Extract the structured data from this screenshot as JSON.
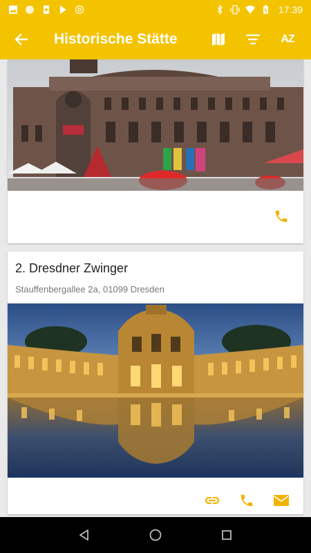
{
  "status_bar": {
    "time": "17:39",
    "left_icons": [
      "image-icon",
      "circle-icon",
      "battery-saver-icon",
      "play-store-icon",
      "at-sign-icon"
    ],
    "right_icons": [
      "bluetooth-icon",
      "vibrate-icon",
      "wifi-icon",
      "battery-icon"
    ]
  },
  "app_bar": {
    "title": "Historische Stätte",
    "back_icon": "arrow-left-icon",
    "actions": [
      "map-icon",
      "filter-icon",
      "sort-az-icon"
    ],
    "sort_label": "AZ"
  },
  "cards": [
    {
      "title": "",
      "address": "",
      "image": "semperoper-photo",
      "actions": [
        "phone-icon"
      ]
    },
    {
      "title": "2. Dresdner Zwinger",
      "address": "Stauffenbergallee 2a, 01099 Dresden",
      "image": "zwinger-photo",
      "actions": [
        "link-icon",
        "phone-icon",
        "mail-icon"
      ]
    }
  ],
  "colors": {
    "accent": "#f4c300",
    "icon_accent": "#f0b400"
  }
}
